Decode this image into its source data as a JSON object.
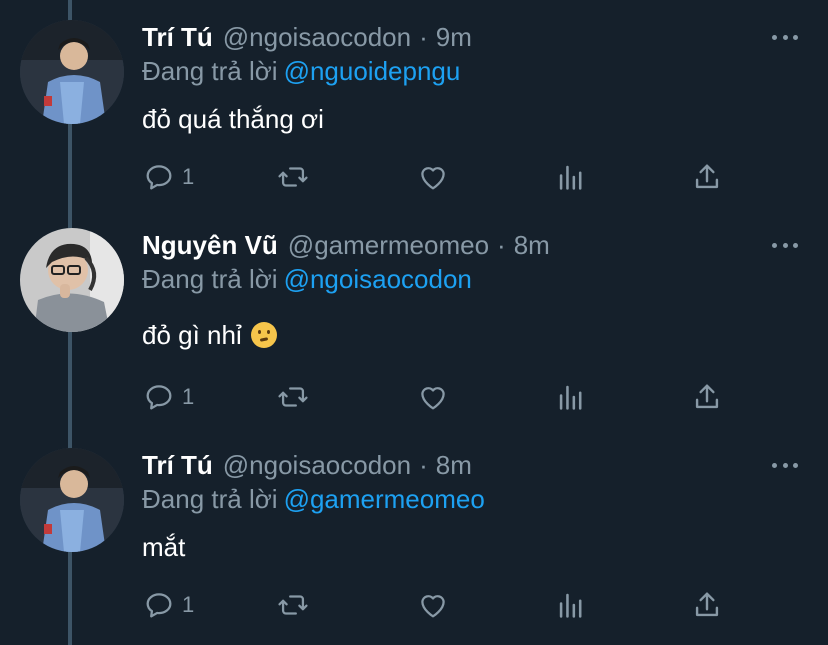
{
  "tweets": [
    {
      "name": "Trí Tú",
      "handle": "@ngoisaocodon",
      "separator": "·",
      "time": "9m",
      "reply_prefix": "Đang trả lời",
      "reply_to": "@nguoidepngu",
      "text": "đỏ quá thắng ơi",
      "reply_count": "1",
      "avatar_icon": "user-avatar-photo"
    },
    {
      "name": "Nguyên Vũ",
      "handle": "@gamermeomeo",
      "separator": "·",
      "time": "8m",
      "reply_prefix": "Đang trả lời",
      "reply_to": "@ngoisaocodon",
      "text": "đỏ gì nhỉ",
      "emoji": "thinking-face-emoji",
      "reply_count": "1",
      "avatar_icon": "user-avatar-photo"
    },
    {
      "name": "Trí Tú",
      "handle": "@ngoisaocodon",
      "separator": "·",
      "time": "8m",
      "reply_prefix": "Đang trả lời",
      "reply_to": "@gamermeomeo",
      "text": "mắt",
      "reply_count": "1",
      "avatar_icon": "user-avatar-photo"
    }
  ],
  "colors": {
    "background": "#15202b",
    "secondary_text": "#8899a6",
    "link": "#1da1f2",
    "thread_line": "#3d5466"
  }
}
